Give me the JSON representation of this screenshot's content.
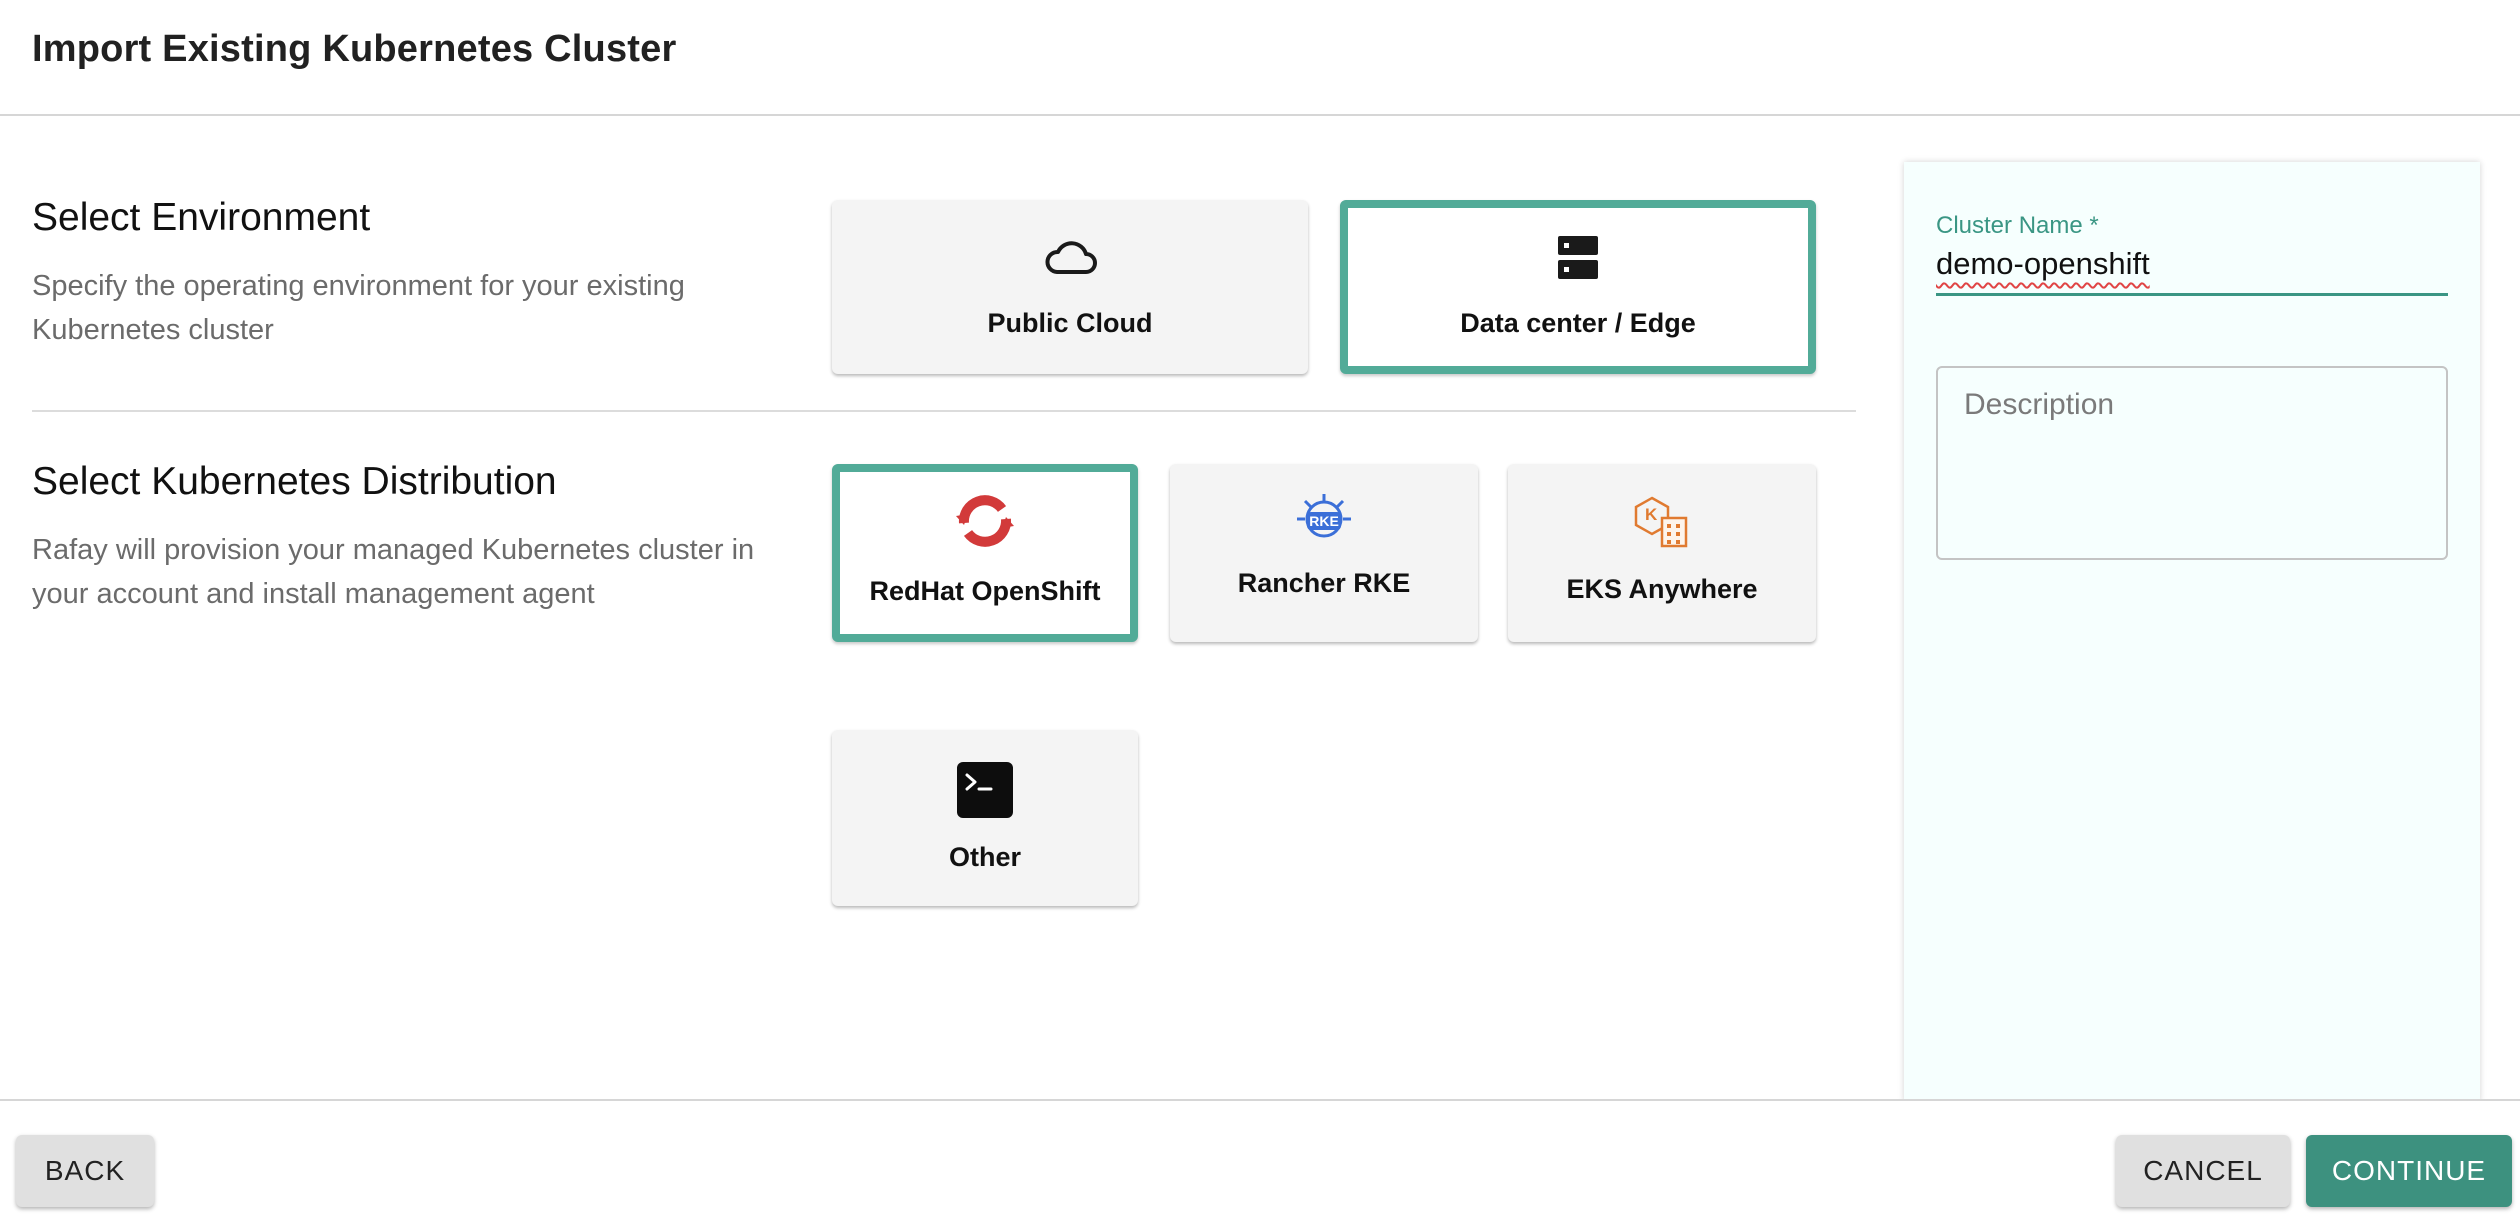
{
  "header": {
    "title": "Import Existing Kubernetes Cluster"
  },
  "environment": {
    "title": "Select Environment",
    "description": "Specify the operating environment for your existing Kubernetes cluster",
    "options": [
      {
        "label": "Public Cloud",
        "icon": "cloud-icon",
        "selected": false
      },
      {
        "label": "Data center / Edge",
        "icon": "server-icon",
        "selected": true
      }
    ]
  },
  "distribution": {
    "title": "Select Kubernetes Distribution",
    "description": "Rafay will provision your managed Kubernetes cluster in your account and install management agent",
    "options": [
      {
        "label": "RedHat OpenShift",
        "icon": "openshift-icon",
        "selected": true
      },
      {
        "label": "Rancher RKE",
        "icon": "rancher-rke-icon",
        "icon_text": "RKE",
        "selected": false
      },
      {
        "label": "EKS Anywhere",
        "icon": "eks-anywhere-icon",
        "icon_text": "K",
        "selected": false
      },
      {
        "label": "Other",
        "icon": "terminal-icon",
        "selected": false
      }
    ]
  },
  "form": {
    "cluster_name_label": "Cluster Name *",
    "cluster_name_value": "demo-openshift",
    "description_placeholder": "Description"
  },
  "footer": {
    "back_label": "BACK",
    "cancel_label": "CANCEL",
    "continue_label": "CONTINUE"
  },
  "colors": {
    "accent": "#52ab98",
    "primary_button": "#3d917f",
    "openshift_red": "#d23a3a",
    "rancher_blue": "#3b6fd8",
    "eks_orange": "#e07a30"
  }
}
